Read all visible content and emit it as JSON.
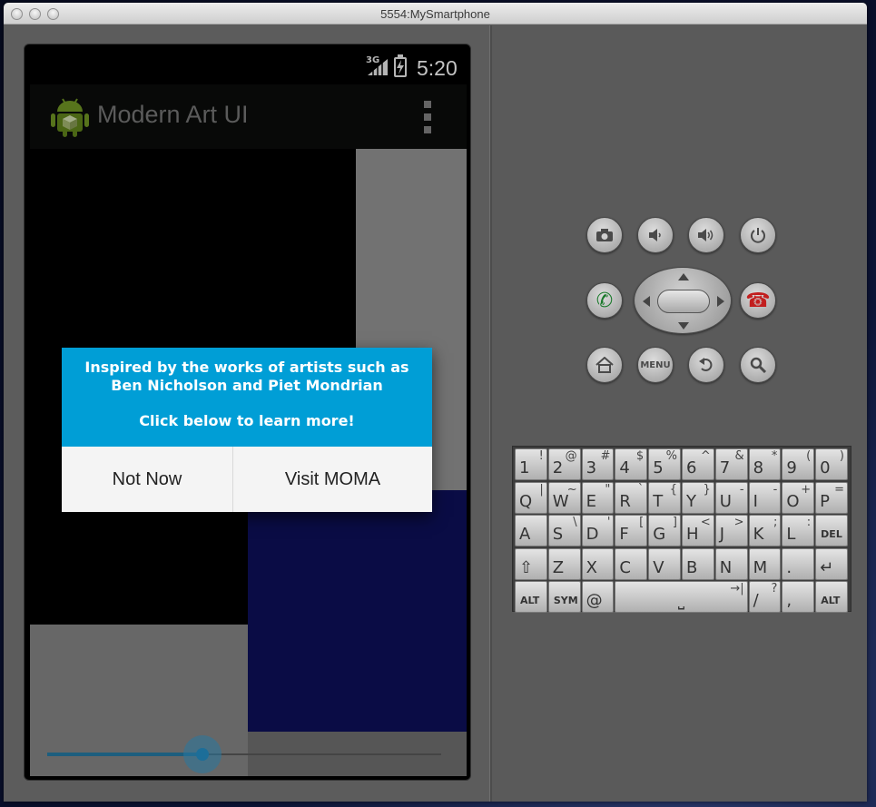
{
  "window": {
    "title": "5554:MySmartphone"
  },
  "status_bar": {
    "network": "3G",
    "time": "5:20"
  },
  "app": {
    "title": "Modern Art UI"
  },
  "dialog": {
    "message_lines": [
      "Inspired by the works of artists such as",
      "Ben Nicholson and Piet Mondrian",
      "Click below to learn more!"
    ],
    "negative_label": "Not Now",
    "positive_label": "Visit MOMA"
  },
  "seekbar": {
    "value": 0.395
  },
  "controls": {
    "menu_label": "MENU"
  },
  "keyboard": {
    "rows": [
      [
        {
          "main": "1",
          "alt": "!"
        },
        {
          "main": "2",
          "alt": "@"
        },
        {
          "main": "3",
          "alt": "#"
        },
        {
          "main": "4",
          "alt": "$"
        },
        {
          "main": "5",
          "alt": "%"
        },
        {
          "main": "6",
          "alt": "^"
        },
        {
          "main": "7",
          "alt": "&"
        },
        {
          "main": "8",
          "alt": "*"
        },
        {
          "main": "9",
          "alt": "("
        },
        {
          "main": "0",
          "alt": ")"
        }
      ],
      [
        {
          "main": "Q",
          "alt": "|"
        },
        {
          "main": "W",
          "alt": "~"
        },
        {
          "main": "E",
          "alt": "\""
        },
        {
          "main": "R",
          "alt": "`"
        },
        {
          "main": "T",
          "alt": "{"
        },
        {
          "main": "Y",
          "alt": "}"
        },
        {
          "main": "U",
          "alt": "-"
        },
        {
          "main": "I",
          "alt": "-"
        },
        {
          "main": "O",
          "alt": "+"
        },
        {
          "main": "P",
          "alt": "="
        }
      ],
      [
        {
          "main": "A",
          "alt": ""
        },
        {
          "main": "S",
          "alt": "\\"
        },
        {
          "main": "D",
          "alt": "'"
        },
        {
          "main": "F",
          "alt": "["
        },
        {
          "main": "G",
          "alt": "]"
        },
        {
          "main": "H",
          "alt": "<"
        },
        {
          "main": "J",
          "alt": ">"
        },
        {
          "main": "K",
          "alt": ";"
        },
        {
          "main": "L",
          "alt": ":"
        },
        {
          "main": "DEL",
          "alt": ""
        }
      ],
      [
        {
          "main": "⇧",
          "alt": ""
        },
        {
          "main": "Z",
          "alt": ""
        },
        {
          "main": "X",
          "alt": ""
        },
        {
          "main": "C",
          "alt": ""
        },
        {
          "main": "V",
          "alt": ""
        },
        {
          "main": "B",
          "alt": ""
        },
        {
          "main": "N",
          "alt": ""
        },
        {
          "main": "M",
          "alt": ""
        },
        {
          "main": ".",
          "alt": ""
        },
        {
          "main": "↵",
          "alt": ""
        }
      ],
      [
        {
          "main": "ALT",
          "alt": ""
        },
        {
          "main": "SYM",
          "alt": ""
        },
        {
          "main": "@",
          "alt": ""
        },
        {
          "main": "⎵",
          "alt": "→|"
        },
        {
          "main": "/",
          "alt": "?"
        },
        {
          "main": ",",
          "alt": ""
        },
        {
          "main": "ALT",
          "alt": ""
        }
      ]
    ]
  },
  "colors": {
    "dialog_message_bg": "#009ed6",
    "mondrian_navy": "#0d0f55",
    "seekbar_accent": "#1c6e99"
  },
  "icons": {
    "camera": "camera-icon",
    "volume_down": "volume-down-icon",
    "volume_up": "volume-up-icon",
    "power": "power-icon",
    "call": "call-icon",
    "end_call": "end-call-icon",
    "home": "home-icon",
    "back": "back-icon",
    "search": "search-icon"
  }
}
